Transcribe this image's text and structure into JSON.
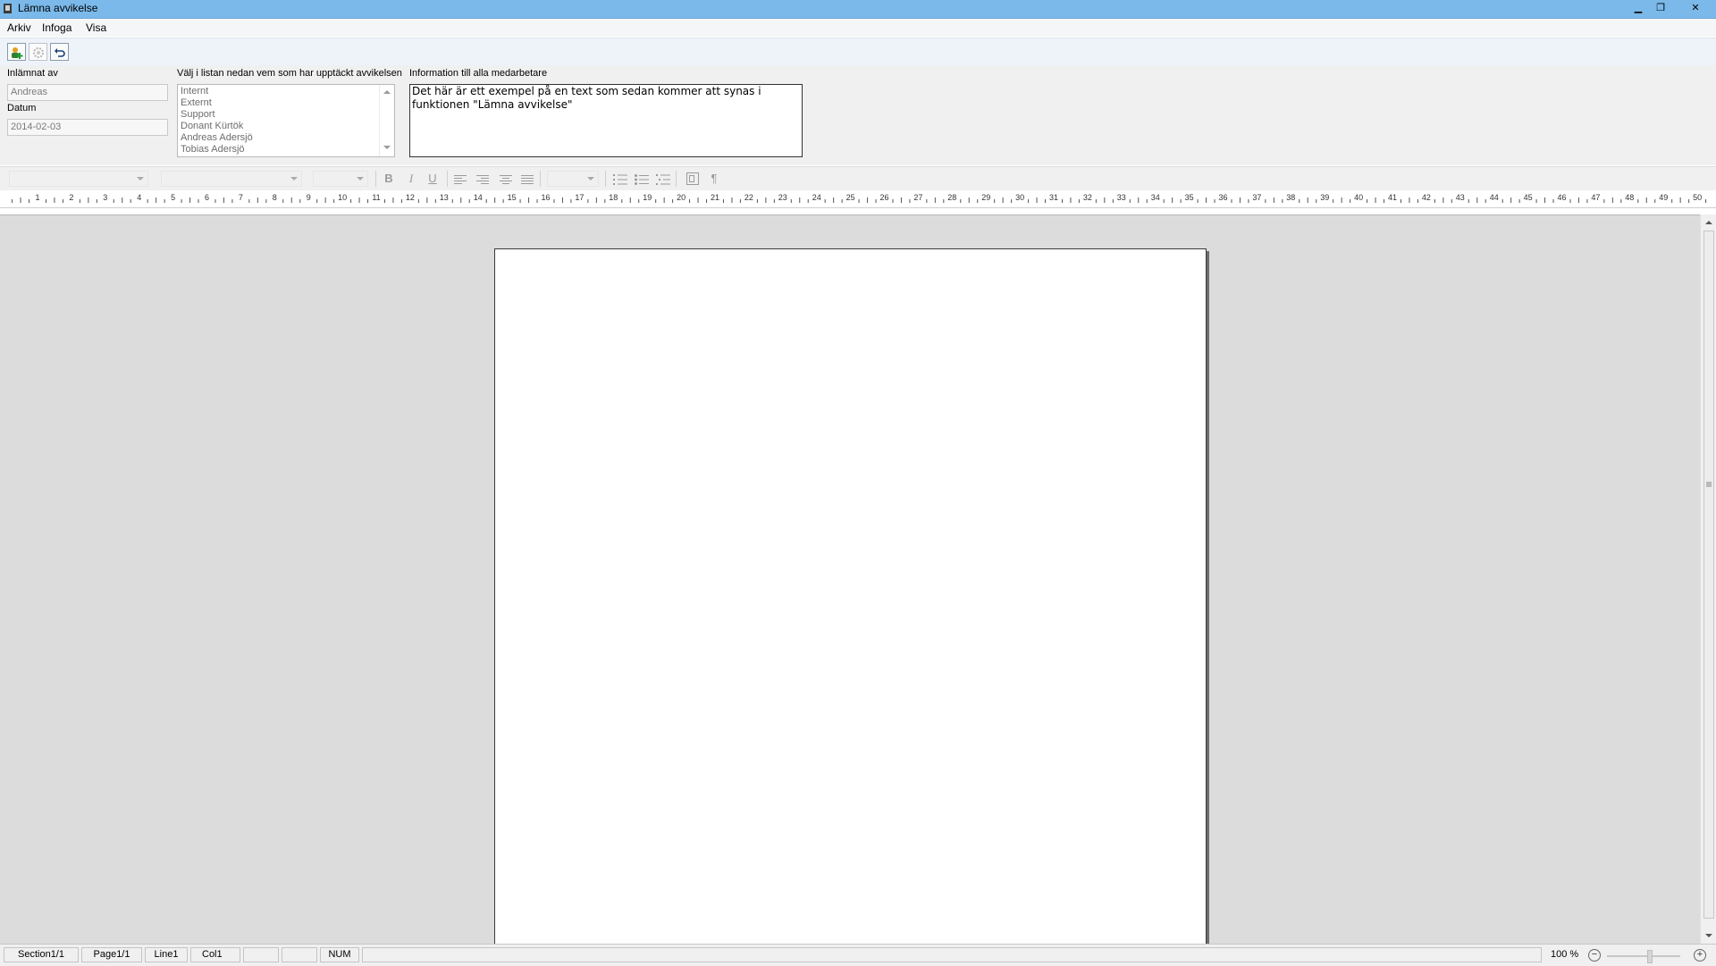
{
  "window": {
    "title": "Lämna avvikelse",
    "minimize_glyph": "▁",
    "maximize_glyph": "❐",
    "close_glyph": "✕"
  },
  "menu": {
    "items": [
      "Arkiv",
      "Infoga",
      "Visa"
    ]
  },
  "toolbar": {
    "buttons": [
      {
        "icon": "add-user-icon",
        "enabled": true
      },
      {
        "icon": "settings-icon",
        "enabled": false
      },
      {
        "icon": "undo-icon",
        "enabled": true
      }
    ]
  },
  "form": {
    "submitted_by_label": "Inlämnat av",
    "submitted_by_value": "Andreas",
    "date_label": "Datum",
    "date_value": "2014-02-03",
    "list_label": "Välj i listan nedan vem som har upptäckt avvikelsen",
    "list_items": [
      "Internt",
      "Externt",
      "Support",
      "Donant Kürtök",
      "Andreas Adersjö",
      "Tobias Adersjö"
    ],
    "info_label": "Information till alla medarbetare",
    "info_text": "Det här är ett exempel på en text som sedan kommer att synas i funktionen \"Lämna avvikelse\""
  },
  "format_toolbar": {
    "bold": "B",
    "italic": "I",
    "underline": "U",
    "pilcrow": "¶"
  },
  "ruler": {
    "labels": [
      "1",
      "2",
      "3",
      "4",
      "5",
      "6",
      "7",
      "8",
      "9",
      "10",
      "11",
      "12",
      "13",
      "14",
      "15",
      "16",
      "17",
      "18",
      "19",
      "20",
      "21",
      "22",
      "23",
      "24",
      "25",
      "26",
      "27",
      "28",
      "29",
      "30",
      "31",
      "32",
      "33",
      "34",
      "35",
      "36",
      "37",
      "38",
      "39",
      "40",
      "41",
      "42",
      "43",
      "44",
      "45",
      "46",
      "47",
      "48",
      "49",
      "50"
    ]
  },
  "statusbar": {
    "section": "Section1/1",
    "page": "Page1/1",
    "line": "Line1",
    "col": "Col1",
    "cell5": "",
    "cell6": "",
    "num": "NUM",
    "zoom": "100 %",
    "zoom_out": "−",
    "zoom_in": "+"
  },
  "colors": {
    "titlebar": "#7ab9ea",
    "toolbar": "#eef3fa",
    "panel": "#f0f0f0",
    "document_bg": "#dcdcdc",
    "page": "#ffffff"
  }
}
